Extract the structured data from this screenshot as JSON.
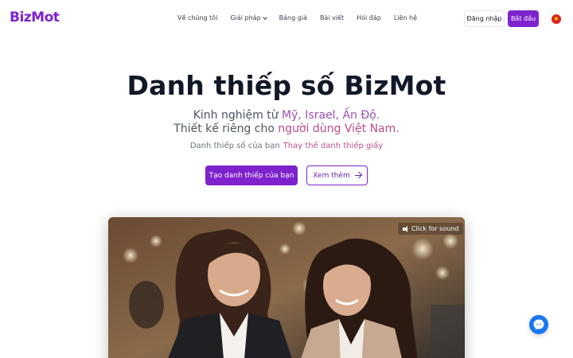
{
  "brand": {
    "logo_text": "BizMot"
  },
  "nav": {
    "items": [
      {
        "label": "Về chúng tôi"
      },
      {
        "label": "Giải pháp",
        "has_dropdown": true
      },
      {
        "label": "Bảng giá"
      },
      {
        "label": "Bài viết"
      },
      {
        "label": "Hỏi đáp"
      },
      {
        "label": "Liên hệ"
      }
    ],
    "login_label": "Đăng nhập",
    "start_label": "Bắt đầu",
    "language_flag": "vietnam-flag-icon"
  },
  "hero": {
    "title": "Danh thiếp số BizMot",
    "line1_prefix": "Kinh nghiệm từ ",
    "line1_highlight": "Mỹ, Israel, Ấn Độ.",
    "line2_prefix": "Thiết kế riêng cho ",
    "line2_highlight": "người dùng Việt Nam.",
    "tagline_prefix": "Danh thiếp số của bạn",
    "tagline_accent": "Thay thế danh thiếp giấy",
    "primary_button": "Tạo danh thiếp của bạn",
    "secondary_button": "Xem thêm"
  },
  "video": {
    "sound_label": "Click for sound"
  },
  "colors": {
    "brand_purple": "#7e22ce",
    "highlight_purple": "#9b4fb8",
    "highlight_pink": "#be4b8b",
    "messenger_blue": "#1877f2"
  },
  "widgets": {
    "chat_icon": "messenger-icon"
  }
}
